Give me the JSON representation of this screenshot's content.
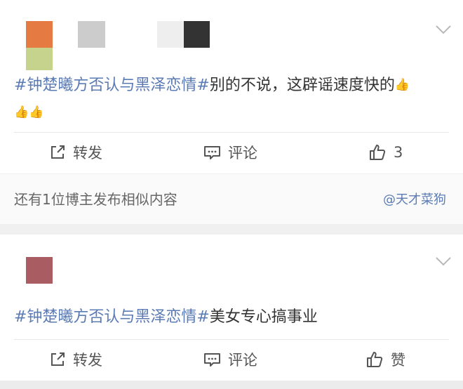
{
  "colors": {
    "hashtag": "#5b7bb4",
    "text": "#333333",
    "muted": "#666666",
    "avatar_orange": "#e57a42",
    "avatar_green": "#c6d38c",
    "avatar_gray": "#cccccc",
    "avatar_lightgray": "#eeeeee",
    "avatar_dark": "#333333",
    "avatar_maroon": "#a95c61"
  },
  "posts": [
    {
      "hashtag": "#钟楚曦方否认与黑泽恋情#",
      "body": "别的不说，这辟谣速度快的",
      "emoji": "👍",
      "actions": {
        "repost": "转发",
        "comment": "评论",
        "like_count": "3"
      }
    },
    {
      "hashtag": "#钟楚曦方否认与黑泽恋情#",
      "body": "美女专心搞事业",
      "actions": {
        "repost": "转发",
        "comment": "评论",
        "like": "赞"
      }
    }
  ],
  "similar": {
    "text": "还有1位博主发布相似内容",
    "link": "@天才菜狗"
  },
  "icons": {
    "repost": "share-arrow-icon",
    "comment": "comment-icon",
    "like": "thumbs-up-icon",
    "menu": "chevron-down-icon"
  }
}
